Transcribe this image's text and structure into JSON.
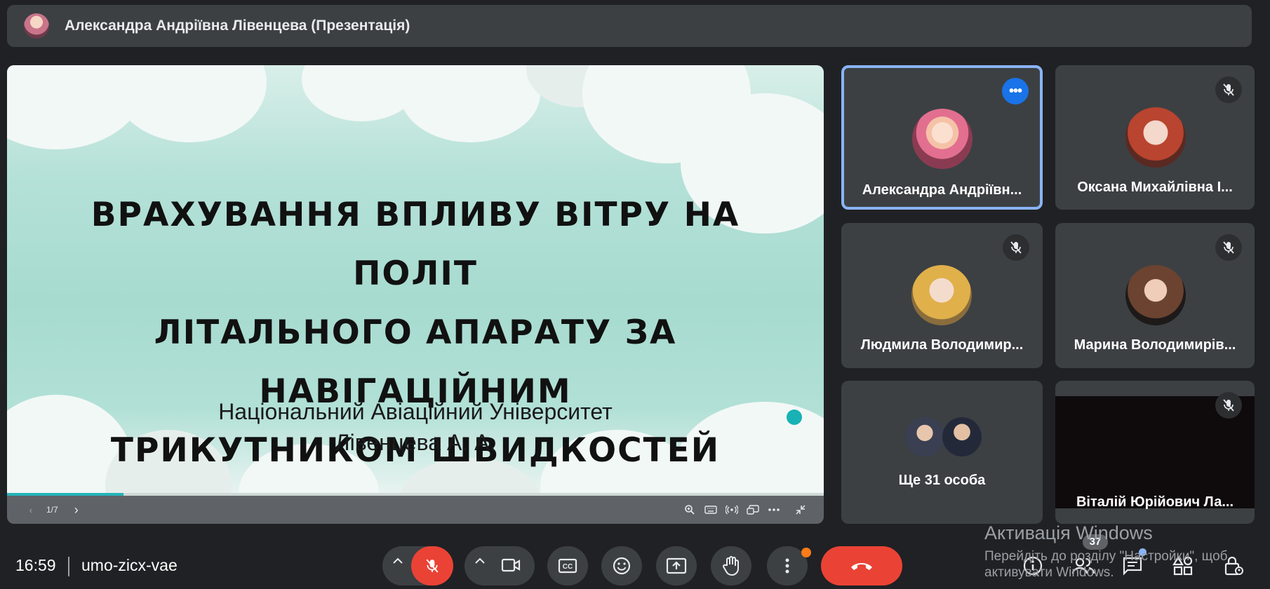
{
  "topbar": {
    "title": "Александра Андріївна Лівенцева (Презентація)"
  },
  "slide": {
    "title_lines": [
      "Врахування впливу вітру на політ",
      "літального апарату за навігаційним",
      "трикутником швидкостей"
    ],
    "subtitle_lines": [
      "Національний Авіаційний Університет",
      "Лівенцева А. А."
    ],
    "page_indicator": "1/7",
    "progress_fraction": 0.143,
    "prev_icon": "‹",
    "next_icon": "›"
  },
  "participants": [
    {
      "name": "Александра Андріївн...",
      "state": "active-speaker"
    },
    {
      "name": "Оксана Михайлівна І...",
      "state": "muted"
    },
    {
      "name": "Людмила Володимир...",
      "state": "muted"
    },
    {
      "name": "Марина Володимирів...",
      "state": "muted"
    },
    {
      "name": "Ще 31 особа",
      "state": "group"
    },
    {
      "name": "Віталій Юрійович Ла...",
      "state": "muted"
    }
  ],
  "bottom_bar": {
    "time": "16:59",
    "meeting_code": "umo-zicx-vae",
    "participant_count": "37",
    "icons": [
      "chevron-up-icon",
      "mic-off-icon",
      "chevron-up-icon",
      "camera-icon",
      "captions-icon",
      "emoji-icon",
      "present-icon",
      "hand-icon",
      "more-vert-icon",
      "end-call-icon",
      "info-icon",
      "people-icon",
      "chat-icon",
      "activities-icon",
      "host-controls-icon"
    ]
  },
  "watermark": {
    "title": "Активація Windows",
    "line1": "Перейдіть до розділу \"Настройки\", щоб",
    "line2": "активувати Windows."
  },
  "colors": {
    "background": "#202124",
    "surface": "#3c4043",
    "accent_blue": "#1a73e8",
    "red": "#ea4335",
    "teal": "#25b4b8",
    "orange": "#fa7b17"
  }
}
